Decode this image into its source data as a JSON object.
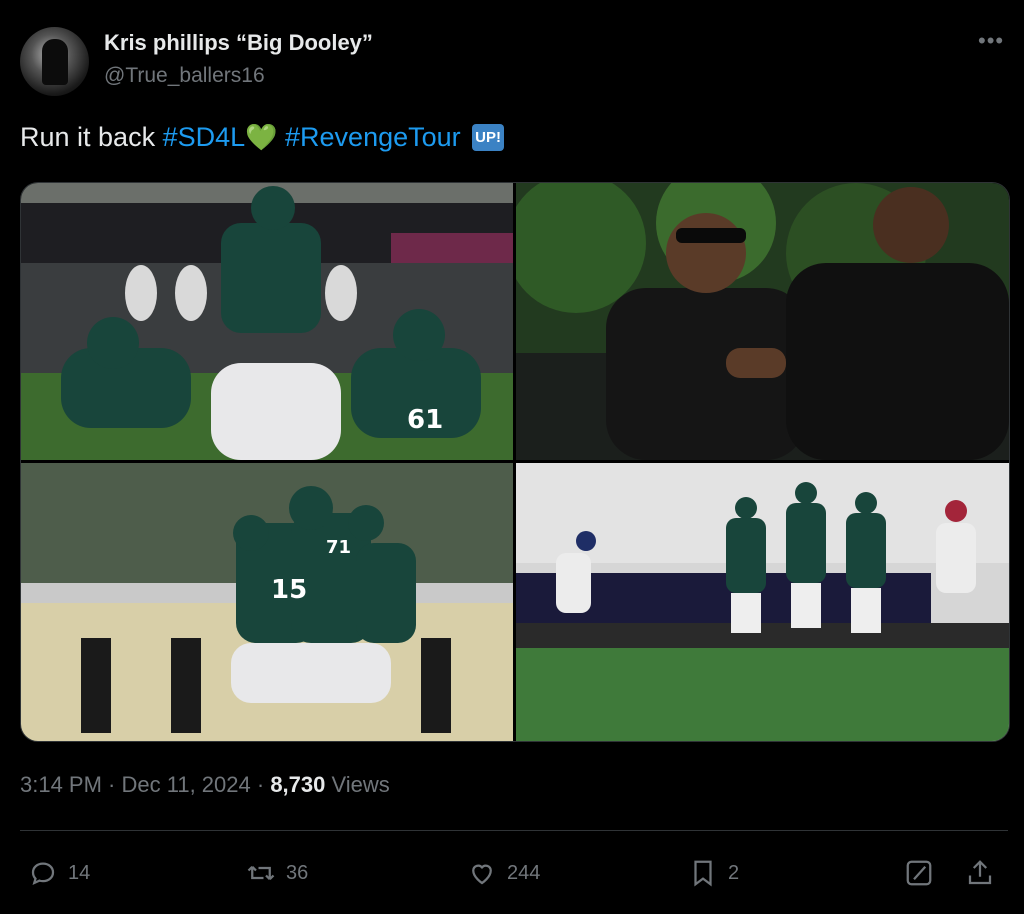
{
  "author": {
    "name": "Kris phillips “Big Dooley”",
    "handle": "@True_ballers16"
  },
  "menu_icon": "more-dots-icon",
  "tweet": {
    "text_plain": "Run it back ",
    "hashtag1": "#SD4L",
    "emoji_heart": "💚",
    "hashtag2": "#RevengeTour",
    "emoji_up": "UP!"
  },
  "photos": [
    {
      "name": "photo-football-line-of-scrimmage"
    },
    {
      "name": "photo-players-arriving-handshake"
    },
    {
      "name": "photo-players-celebrating"
    },
    {
      "name": "photo-kickoff-return"
    }
  ],
  "meta": {
    "time": "3:14 PM",
    "sep1": " · ",
    "date": "Dec 11, 2024",
    "sep2": " · ",
    "views_count": "8,730",
    "views_label": " Views"
  },
  "actions": {
    "reply": {
      "icon": "reply-icon",
      "count": "14"
    },
    "repost": {
      "icon": "repost-icon",
      "count": "36"
    },
    "like": {
      "icon": "heart-icon",
      "count": "244"
    },
    "bookmark": {
      "icon": "bookmark-icon",
      "count": "2"
    },
    "grok": {
      "icon": "grok-icon"
    },
    "share": {
      "icon": "share-icon"
    }
  },
  "colors": {
    "background": "#000000",
    "text": "#e7e9ea",
    "muted": "#71767b",
    "link": "#1d9bf0",
    "msu_green": "#18453b"
  }
}
